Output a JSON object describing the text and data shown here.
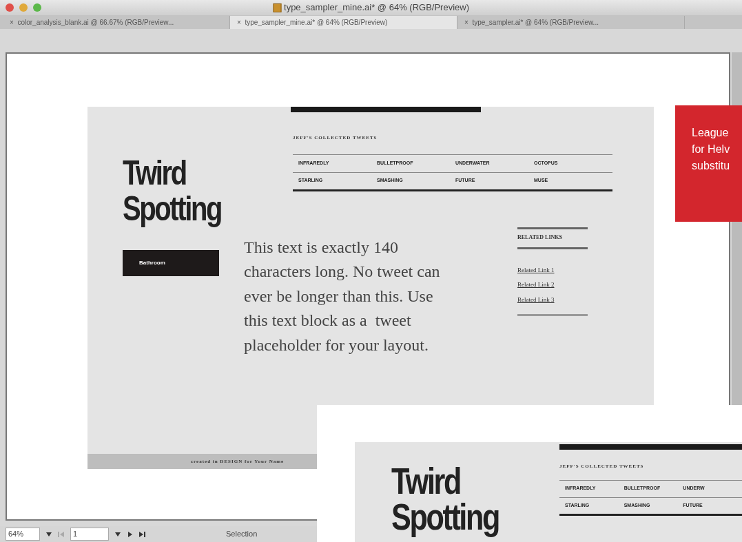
{
  "window": {
    "title": "type_sampler_mine.ai* @ 64% (RGB/Preview)"
  },
  "tabs": [
    {
      "close": "×",
      "label": "color_analysis_blank.ai @ 66.67% (RGB/Preview...",
      "selected": false
    },
    {
      "close": "×",
      "label": "type_sampler_mine.ai* @ 64% (RGB/Preview)",
      "selected": true
    },
    {
      "close": "×",
      "label": "type_sampler.ai* @ 64% (RGB/Preview...",
      "selected": false
    }
  ],
  "artboard": {
    "title_lines": [
      "Twird",
      "Spotting"
    ],
    "button": "Bathroom",
    "section_title": "JEFF'S COLLECTED TWEETS",
    "tag_rows": [
      [
        "INFRAREDLY",
        "BULLETPROOF",
        "UNDERWATER",
        "OCTOPUS"
      ],
      [
        "STARLING",
        "SMASHING",
        "FUTURE",
        "MUSE"
      ]
    ],
    "tweet": "This text is exactly 140 characters long. No tweet can ever be longer than this. Use this text block as a  tweet  placeholder for your layout.",
    "related_title": "RELATED LINKS",
    "links": [
      "Related Link 1",
      "Related Link 2",
      "Related Link 3"
    ],
    "footer": "created in DESIGN for Your Name"
  },
  "status_bar": {
    "zoom": "64%",
    "page": "1",
    "tool": "Selection"
  },
  "note": {
    "lines": [
      "League",
      "for Helv",
      "substitu"
    ]
  },
  "preview": {
    "title_lines": [
      "Twird",
      "Spotting"
    ],
    "section_title": "JEFF'S COLLECTED TWEETS",
    "tag_rows": [
      [
        "INFRAREDLY",
        "BULLETPROOF",
        "UNDERW"
      ],
      [
        "STARLING",
        "SMASHING",
        "FUTURE"
      ]
    ]
  }
}
